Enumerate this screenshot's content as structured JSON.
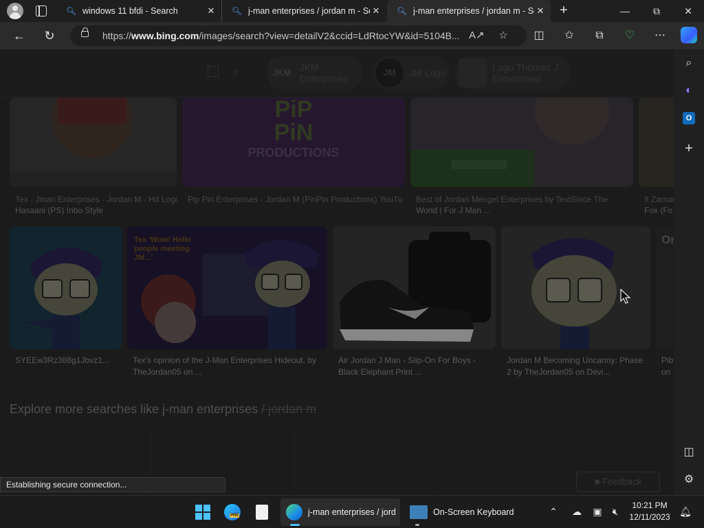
{
  "tabs": [
    {
      "title": "windows 11 bfdi - Search",
      "favicon": "search-icon"
    },
    {
      "title": "j-man enterprises / jordan m - Se",
      "favicon": "search-icon"
    },
    {
      "title": "j-man enterprises / jordan m - Se",
      "favicon": "search-icon",
      "active": true
    }
  ],
  "address_bar": {
    "url_prefix": "https://",
    "url_domain": "www.bing.com",
    "url_rest": "/images/search?view=detailV2&ccid=LdRtocYW&id=5104B..."
  },
  "related_searches": [
    {
      "thumb": "JKM",
      "label": "JKM Enterprises"
    },
    {
      "thumb": "JM",
      "label": "JM Logo"
    },
    {
      "thumb": "",
      "label": "Logo Thomas J Enterprises"
    }
  ],
  "top_row_captions": [
    {
      "line1": "Tex - Jman Enterprises - Jordan M - Hd Logo",
      "line2": "Hasaani (PS) Inbo Style"
    },
    {
      "line1": "Pip Pin Enterprises - Jordan M (PinPin Productions) YouTube",
      "line2": ""
    },
    {
      "line1": "Best of Jordan Mengel Enterprises by TextSince The",
      "line2": "World | For J Man ..."
    },
    {
      "line1": "It Zaman",
      "line2": "Fox (Fo"
    }
  ],
  "pip_pin_text": {
    "line1": "PiP",
    "line2": "PiN",
    "line3": "PRODUCTIONS"
  },
  "second_row_captions": [
    {
      "line1": "SYEEw3Rz388g1Jbvz1...",
      "line2": ""
    },
    {
      "line1": "Tex's opinion of the J-Man Enterprises Hideout. by",
      "line2": "TheJordan05 on ..."
    },
    {
      "line1": "Air Jordan J Man - Slip-On For Boys -",
      "line2": "Black Elephant Print ..."
    },
    {
      "line1": "Jordan M Becoming Uncanny: Phase",
      "line2": "2 by TheJordan05 on Devi..."
    },
    {
      "line1": "Pib",
      "line2": "on"
    }
  ],
  "second_row_image_texts": {
    "tex_overlay": "Tex 'Wow! Hello people meeting JM...'",
    "partial_card": "Or"
  },
  "explore": {
    "text": "Explore more searches like j-man enterprises",
    "strike": "/ jordan m"
  },
  "feedback_label": "Feedback",
  "status_text": "Establishing secure connection...",
  "taskbar": {
    "edge_label": "j-man enterprises / jord",
    "keyboard_label": "On-Screen Keyboard",
    "time": "10:21 PM",
    "date": "12/11/2023",
    "pre_badge": "PRE"
  }
}
